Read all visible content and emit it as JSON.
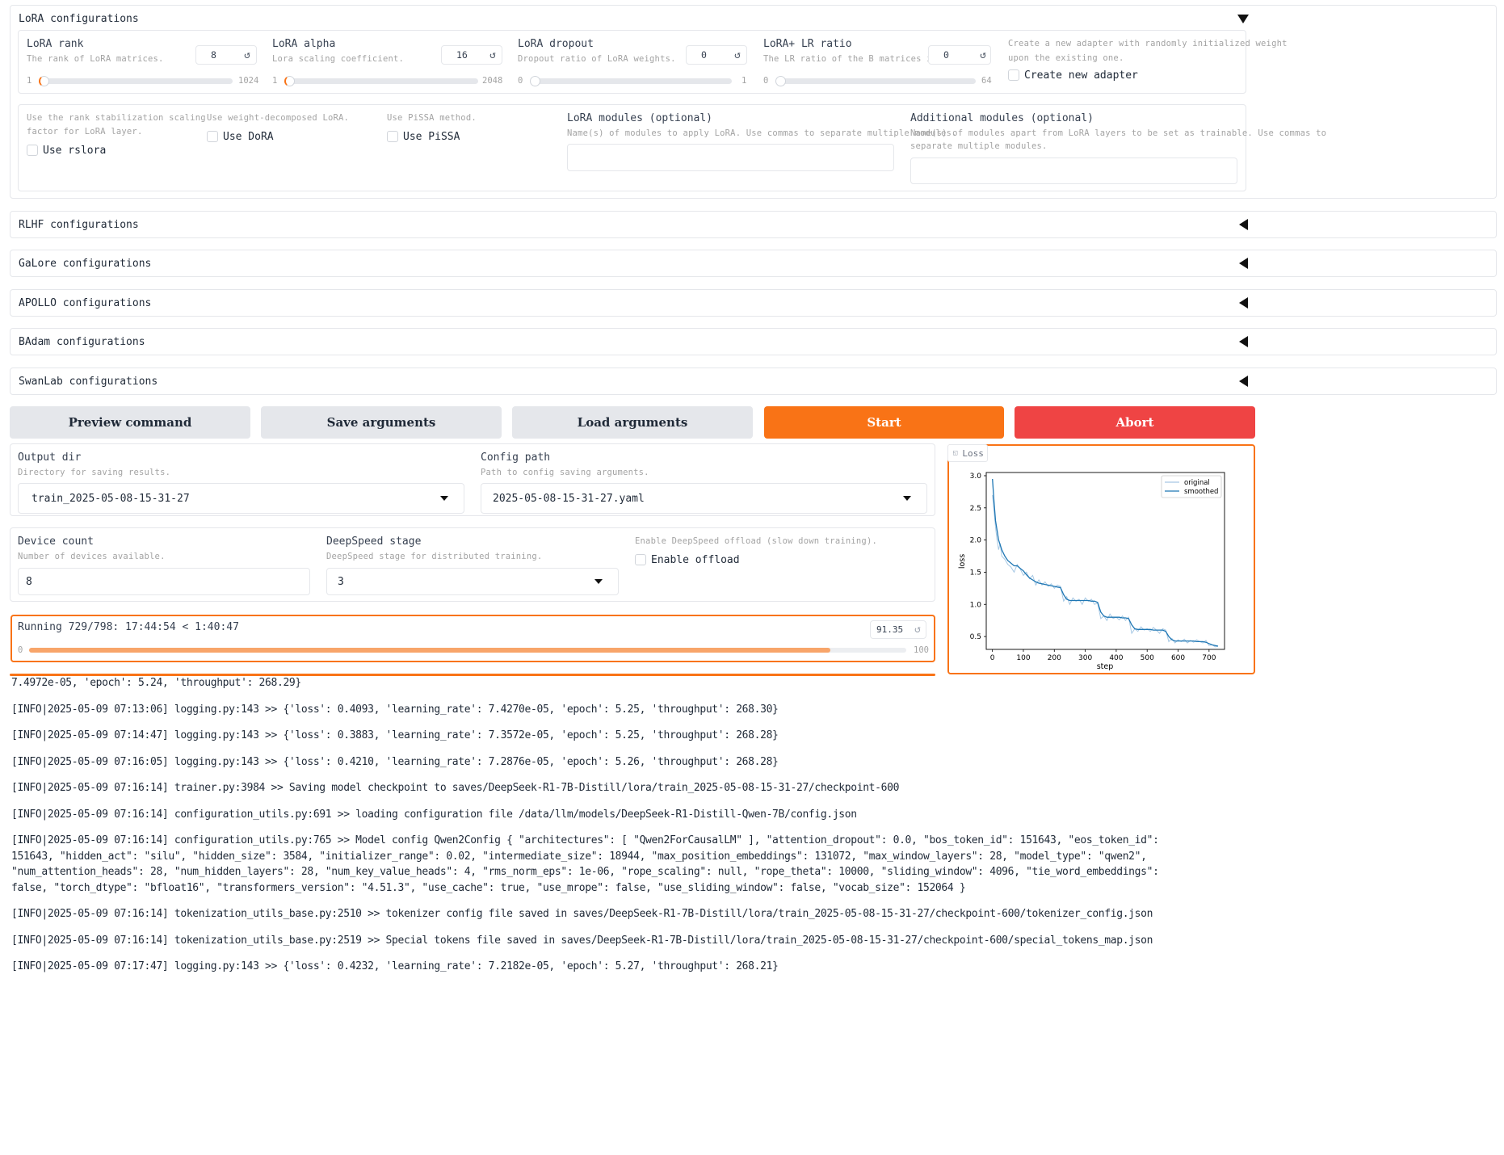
{
  "lora": {
    "title": "LoRA configurations",
    "rank": {
      "label": "LoRA rank",
      "info": "The rank of LoRA matrices.",
      "value": "8",
      "min": "1",
      "max": "1024"
    },
    "alpha": {
      "label": "LoRA alpha",
      "info": "Lora scaling coefficient.",
      "value": "16",
      "min": "1",
      "max": "2048"
    },
    "dropout": {
      "label": "LoRA dropout",
      "info": "Dropout ratio of LoRA weights.",
      "value": "0",
      "min": "0",
      "max": "1"
    },
    "plus_ratio": {
      "label": "LoRA+ LR ratio",
      "info": "The LR ratio of the B matrices in LoRA.",
      "value": "0",
      "min": "0",
      "max": "64"
    },
    "create_new": {
      "info_l1": "Create a new adapter with randomly initialized weight",
      "info_l2": "upon the existing one.",
      "label": "Create new adapter"
    },
    "rslora": {
      "info_l1": "Use the rank stabilization scaling",
      "info_l2": "factor for LoRA layer.",
      "label": "Use rslora"
    },
    "dora": {
      "info": "Use weight-decomposed LoRA.",
      "label": "Use DoRA"
    },
    "pissa": {
      "info": "Use PiSSA method.",
      "label": "Use PiSSA"
    },
    "modules": {
      "label": "LoRA modules (optional)",
      "info": "Name(s) of modules to apply LoRA. Use commas to separate multiple modules.",
      "value": ""
    },
    "additional": {
      "label": "Additional modules (optional)",
      "info_l1": "Name(s) of modules apart from LoRA layers to be set as trainable. Use commas to",
      "info_l2": "separate multiple modules.",
      "value": ""
    }
  },
  "sections": {
    "rlhf": "RLHF configurations",
    "galore": "GaLore configurations",
    "apollo": "APOLLO configurations",
    "badam": "BAdam configurations",
    "swanlab": "SwanLab configurations"
  },
  "buttons": {
    "preview": "Preview command",
    "save": "Save arguments",
    "load": "Load arguments",
    "start": "Start",
    "abort": "Abort"
  },
  "output": {
    "dir_label": "Output dir",
    "dir_info": "Directory for saving results.",
    "dir_value": "train_2025-05-08-15-31-27",
    "config_label": "Config path",
    "config_info": "Path to config saving arguments.",
    "config_value": "2025-05-08-15-31-27.yaml"
  },
  "device": {
    "label": "Device count",
    "info": "Number of devices available.",
    "value": "8"
  },
  "deepspeed": {
    "label": "DeepSpeed stage",
    "info": "DeepSpeed stage for distributed training.",
    "value": "3"
  },
  "offload": {
    "info": "Enable DeepSpeed offload (slow down training).",
    "label": "Enable offload"
  },
  "progress": {
    "text": "Running 729/798: 17:44:54 < 1:40:47",
    "value": "91.35",
    "min": "0",
    "max": "100",
    "fraction": 0.9135
  },
  "colors": {
    "accent": "#f97316",
    "abort": "#ef4444",
    "series": "#1f77b4",
    "series_light": "#a6c8e4"
  },
  "logs": [
    "7.4972e-05, 'epoch': 5.24, 'throughput': 268.29}",
    "[INFO|2025-05-09 07:13:06] logging.py:143 >> {'loss': 0.4093, 'learning_rate': 7.4270e-05, 'epoch': 5.25, 'throughput': 268.30}",
    "[INFO|2025-05-09 07:14:47] logging.py:143 >> {'loss': 0.3883, 'learning_rate': 7.3572e-05, 'epoch': 5.25, 'throughput': 268.28}",
    "[INFO|2025-05-09 07:16:05] logging.py:143 >> {'loss': 0.4210, 'learning_rate': 7.2876e-05, 'epoch': 5.26, 'throughput': 268.28}",
    "[INFO|2025-05-09 07:16:14] trainer.py:3984 >> Saving model checkpoint to saves/DeepSeek-R1-7B-Distill/lora/train_2025-05-08-15-31-27/checkpoint-600",
    "[INFO|2025-05-09 07:16:14] configuration_utils.py:691 >> loading configuration file /data/llm/models/DeepSeek-R1-Distill-Qwen-7B/config.json",
    "[INFO|2025-05-09 07:16:14] configuration_utils.py:765 >> Model config Qwen2Config { \"architectures\": [ \"Qwen2ForCausalLM\" ], \"attention_dropout\": 0.0, \"bos_token_id\": 151643, \"eos_token_id\":",
    "151643, \"hidden_act\": \"silu\", \"hidden_size\": 3584, \"initializer_range\": 0.02, \"intermediate_size\": 18944, \"max_position_embeddings\": 131072, \"max_window_layers\": 28, \"model_type\": \"qwen2\",",
    "\"num_attention_heads\": 28, \"num_hidden_layers\": 28, \"num_key_value_heads\": 4, \"rms_norm_eps\": 1e-06, \"rope_scaling\": null, \"rope_theta\": 10000, \"sliding_window\": 4096, \"tie_word_embeddings\":",
    "false, \"torch_dtype\": \"bfloat16\", \"transformers_version\": \"4.51.3\", \"use_cache\": true, \"use_mrope\": false, \"use_sliding_window\": false, \"vocab_size\": 152064 }",
    "[INFO|2025-05-09 07:16:14] tokenization_utils_base.py:2510 >> tokenizer config file saved in saves/DeepSeek-R1-7B-Distill/lora/train_2025-05-08-15-31-27/checkpoint-600/tokenizer_config.json",
    "[INFO|2025-05-09 07:16:14] tokenization_utils_base.py:2519 >> Special tokens file saved in saves/DeepSeek-R1-7B-Distill/lora/train_2025-05-08-15-31-27/checkpoint-600/special_tokens_map.json",
    "[INFO|2025-05-09 07:17:47] logging.py:143 >> {'loss': 0.4232, 'learning_rate': 7.2182e-05, 'epoch': 5.27, 'throughput': 268.21}"
  ],
  "chart_data": {
    "type": "line",
    "panel_label": "Loss",
    "xlabel": "step",
    "ylabel": "loss",
    "xlim": [
      -20,
      750
    ],
    "ylim": [
      0.3,
      3.05
    ],
    "xticks": [
      "0",
      "100",
      "200",
      "300",
      "400",
      "500",
      "600",
      "700"
    ],
    "yticks": [
      "0.5",
      "1.0",
      "1.5",
      "2.0",
      "2.5",
      "3.0"
    ],
    "legend_position": "top-right",
    "series": [
      {
        "name": "original",
        "x": [
          0,
          5,
          10,
          15,
          20,
          25,
          30,
          40,
          50,
          60,
          70,
          80,
          90,
          100,
          110,
          120,
          130,
          140,
          150,
          160,
          170,
          180,
          190,
          200,
          210,
          220,
          230,
          240,
          250,
          260,
          270,
          280,
          290,
          300,
          310,
          320,
          330,
          340,
          350,
          360,
          370,
          380,
          390,
          400,
          410,
          420,
          430,
          440,
          450,
          460,
          470,
          480,
          490,
          500,
          510,
          520,
          530,
          540,
          550,
          560,
          570,
          580,
          590,
          600,
          610,
          620,
          630,
          640,
          650,
          660,
          670,
          680,
          690,
          700,
          710,
          720,
          729
        ],
        "y": [
          2.7,
          2.45,
          2.2,
          2.0,
          1.85,
          1.95,
          1.75,
          1.7,
          1.62,
          1.58,
          1.5,
          1.62,
          1.55,
          1.45,
          1.5,
          1.4,
          1.45,
          1.3,
          1.38,
          1.3,
          1.35,
          1.28,
          1.32,
          1.25,
          1.3,
          1.28,
          1.05,
          1.12,
          1.0,
          1.1,
          1.05,
          1.08,
          1.0,
          1.1,
          1.05,
          1.08,
          1.0,
          1.02,
          0.78,
          0.82,
          0.75,
          0.85,
          0.78,
          0.8,
          0.76,
          0.82,
          0.75,
          0.8,
          0.55,
          0.62,
          0.58,
          0.65,
          0.6,
          0.62,
          0.58,
          0.64,
          0.6,
          0.55,
          0.62,
          0.6,
          0.42,
          0.47,
          0.4,
          0.45,
          0.42,
          0.46,
          0.4,
          0.44,
          0.41,
          0.45,
          0.42,
          0.4,
          0.44,
          0.36,
          0.37,
          0.34,
          0.35
        ]
      },
      {
        "name": "smoothed",
        "x": [
          0,
          5,
          10,
          20,
          30,
          40,
          50,
          60,
          70,
          80,
          90,
          100,
          110,
          120,
          130,
          140,
          150,
          160,
          170,
          180,
          190,
          200,
          210,
          220,
          230,
          240,
          250,
          260,
          270,
          280,
          290,
          300,
          310,
          320,
          330,
          340,
          350,
          360,
          370,
          380,
          390,
          400,
          410,
          420,
          430,
          440,
          450,
          460,
          470,
          480,
          490,
          500,
          510,
          520,
          530,
          540,
          550,
          560,
          570,
          580,
          590,
          600,
          610,
          620,
          630,
          640,
          650,
          660,
          670,
          680,
          690,
          700,
          710,
          720,
          729
        ],
        "y": [
          2.95,
          2.6,
          2.3,
          2.0,
          1.85,
          1.75,
          1.68,
          1.64,
          1.6,
          1.6,
          1.56,
          1.52,
          1.46,
          1.41,
          1.38,
          1.35,
          1.33,
          1.32,
          1.31,
          1.3,
          1.29,
          1.28,
          1.27,
          1.26,
          1.15,
          1.08,
          1.06,
          1.06,
          1.06,
          1.06,
          1.06,
          1.06,
          1.06,
          1.05,
          1.05,
          1.03,
          0.88,
          0.82,
          0.8,
          0.8,
          0.8,
          0.8,
          0.8,
          0.79,
          0.79,
          0.78,
          0.68,
          0.62,
          0.61,
          0.61,
          0.61,
          0.61,
          0.61,
          0.6,
          0.6,
          0.6,
          0.6,
          0.58,
          0.5,
          0.45,
          0.43,
          0.43,
          0.43,
          0.43,
          0.43,
          0.43,
          0.43,
          0.42,
          0.42,
          0.42,
          0.41,
          0.39,
          0.37,
          0.36,
          0.35
        ]
      }
    ]
  }
}
